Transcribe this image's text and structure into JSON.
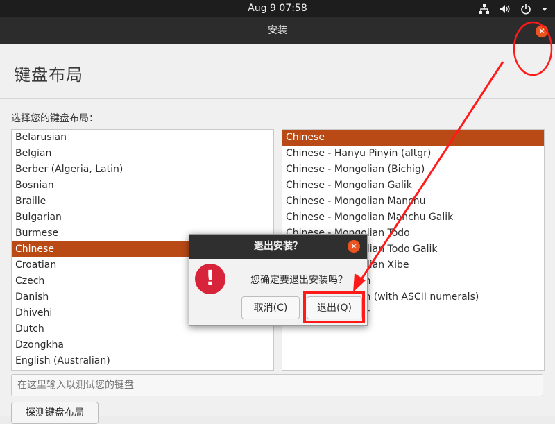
{
  "topbar": {
    "clock": "Aug 9  07:58",
    "icons": [
      "network-icon",
      "volume-icon",
      "power-icon",
      "chevron-down-icon"
    ]
  },
  "window": {
    "title": "安装",
    "close_glyph": "✕"
  },
  "page": {
    "heading": "键盘布局",
    "prompt": "选择您的键盘布局："
  },
  "layouts": [
    {
      "label": "Belarusian",
      "selected": false
    },
    {
      "label": "Belgian",
      "selected": false
    },
    {
      "label": "Berber (Algeria, Latin)",
      "selected": false
    },
    {
      "label": "Bosnian",
      "selected": false
    },
    {
      "label": "Braille",
      "selected": false
    },
    {
      "label": "Bulgarian",
      "selected": false
    },
    {
      "label": "Burmese",
      "selected": false
    },
    {
      "label": "Chinese",
      "selected": true
    },
    {
      "label": "Croatian",
      "selected": false
    },
    {
      "label": "Czech",
      "selected": false
    },
    {
      "label": "Danish",
      "selected": false
    },
    {
      "label": "Dhivehi",
      "selected": false
    },
    {
      "label": "Dutch",
      "selected": false
    },
    {
      "label": "Dzongkha",
      "selected": false
    },
    {
      "label": "English (Australian)",
      "selected": false
    }
  ],
  "variants": [
    {
      "label": "Chinese",
      "selected": true
    },
    {
      "label": "Chinese - Hanyu Pinyin (altgr)",
      "selected": false
    },
    {
      "label": "Chinese - Mongolian (Bichig)",
      "selected": false
    },
    {
      "label": "Chinese - Mongolian Galik",
      "selected": false
    },
    {
      "label": "Chinese - Mongolian Manchu",
      "selected": false
    },
    {
      "label": "Chinese - Mongolian Manchu Galik",
      "selected": false
    },
    {
      "label": "Chinese - Mongolian Todo",
      "selected": false
    },
    {
      "label": "Chinese - Mongolian Todo Galik",
      "selected": false
    },
    {
      "label": "Chinese - Mongolian Xibe",
      "selected": false
    },
    {
      "label": "Chinese - Tibetan",
      "selected": false
    },
    {
      "label": "Chinese - Tibetan (with ASCII numerals)",
      "selected": false
    },
    {
      "label": "Chinese - Uyghur",
      "selected": false
    }
  ],
  "test_input": {
    "placeholder": "在这里输入以测试您的键盘"
  },
  "detect_button": "探测键盘布局",
  "dialog": {
    "title": "退出安装？",
    "close_glyph": "✕",
    "icon_glyph": "!",
    "message": "您确定要退出安装吗？",
    "cancel_label": "取消(C)",
    "quit_label": "退出(Q)"
  },
  "colors": {
    "accent": "#e95420",
    "selection": "#b94a16",
    "annotation": "#ff1a1a",
    "error_icon": "#d7243a"
  }
}
